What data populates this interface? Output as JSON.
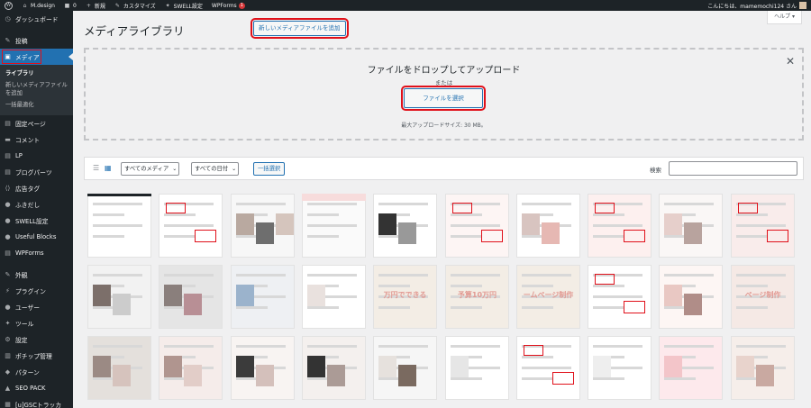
{
  "adminbar": {
    "site_name": "M.design",
    "comments_count": "0",
    "new_label": "新規",
    "customize_label": "カスタマイズ",
    "swell_label": "SWELL設定",
    "wpforms_label": "WPForms",
    "wpforms_badge": "1",
    "greeting": "こんにちは、mamemochi124 さん"
  },
  "sidebar": {
    "items": [
      {
        "label": "ダッシュボード",
        "icon": "dashboard-icon"
      },
      {
        "label": "投稿",
        "icon": "pin-icon"
      },
      {
        "label": "メディア",
        "icon": "media-icon"
      },
      {
        "label": "固定ページ",
        "icon": "page-icon"
      },
      {
        "label": "コメント",
        "icon": "comment-icon"
      },
      {
        "label": "LP",
        "icon": "page-icon"
      },
      {
        "label": "ブログパーツ",
        "icon": "page-icon"
      },
      {
        "label": "広告タグ",
        "icon": "code-icon"
      },
      {
        "label": "ふきだし",
        "icon": "bubble-icon"
      },
      {
        "label": "SWELL設定",
        "icon": "swell-icon"
      },
      {
        "label": "Useful Blocks",
        "icon": "blocks-icon"
      },
      {
        "label": "WPForms",
        "icon": "forms-icon"
      },
      {
        "label": "外観",
        "icon": "brush-icon"
      },
      {
        "label": "プラグイン",
        "icon": "plugin-icon"
      },
      {
        "label": "ユーザー",
        "icon": "user-icon"
      },
      {
        "label": "ツール",
        "icon": "wrench-icon"
      },
      {
        "label": "設定",
        "icon": "settings-icon"
      },
      {
        "label": "ポチップ管理",
        "icon": "cart-icon"
      },
      {
        "label": "パターン",
        "icon": "pattern-icon"
      },
      {
        "label": "SEO PACK",
        "icon": "seo-icon"
      },
      {
        "label": "[u]GSCトラッカ",
        "icon": "chart-icon"
      }
    ],
    "submenu": {
      "library": "ライブラリ",
      "add_new": "新しいメディアファイルを追加",
      "bulk_optimize": "一括最適化"
    }
  },
  "main": {
    "title": "メディアライブラリ",
    "add_new_button": "新しいメディアファイルを追加",
    "help_tab": "ヘルプ ▾",
    "uploader": {
      "drop_text": "ファイルをドロップしてアップロード",
      "or_text": "または",
      "select_button": "ファイルを選択",
      "max_size": "最大アップロードサイズ: 30 MB。"
    },
    "toolbar": {
      "media_filter": "すべてのメディア",
      "date_filter": "すべての日付",
      "bulk_select": "一括選択",
      "search_label": "検索"
    },
    "thumbnails": [
      {
        "label": ""
      },
      {
        "label": ""
      },
      {
        "label": ""
      },
      {
        "label": ""
      },
      {
        "label": ""
      },
      {
        "label": ""
      },
      {
        "label": ""
      },
      {
        "label": ""
      },
      {
        "label": ""
      },
      {
        "label": ""
      },
      {
        "label": ""
      },
      {
        "label": ""
      },
      {
        "label": ""
      },
      {
        "label": ""
      },
      {
        "label": "万円でできる"
      },
      {
        "label": "予算10万円"
      },
      {
        "label": "ームページ制作"
      },
      {
        "label": ""
      },
      {
        "label": ""
      },
      {
        "label": "ページ制作"
      },
      {
        "label": ""
      },
      {
        "label": ""
      },
      {
        "label": ""
      },
      {
        "label": ""
      },
      {
        "label": ""
      },
      {
        "label": ""
      },
      {
        "label": ""
      },
      {
        "label": ""
      },
      {
        "label": ""
      },
      {
        "label": ""
      }
    ]
  },
  "colors": {
    "accent": "#2271b1",
    "highlight": "#e0101a",
    "sidebar_bg": "#1d2327"
  }
}
